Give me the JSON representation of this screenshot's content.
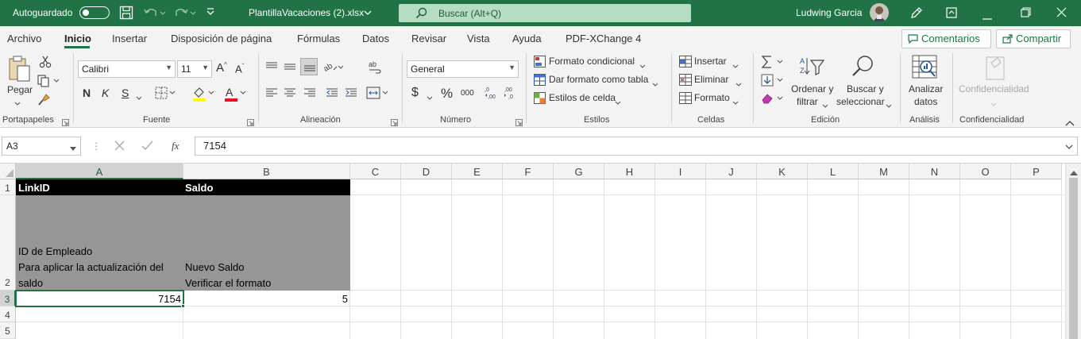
{
  "titlebar": {
    "autosave_label": "Autoguardado",
    "filename": "PlantillaVacaciones (2).xlsx",
    "search_placeholder": "Buscar (Alt+Q)",
    "user_name": "Ludwing Garcia"
  },
  "menu": {
    "tabs": [
      "Archivo",
      "Inicio",
      "Insertar",
      "Disposición de página",
      "Fórmulas",
      "Datos",
      "Revisar",
      "Vista",
      "Ayuda",
      "PDF-XChange 4"
    ],
    "comments_label": "Comentarios",
    "share_label": "Compartir"
  },
  "ribbon": {
    "clipboard": {
      "paste_label": "Pegar",
      "group": "Portapapeles"
    },
    "font": {
      "name": "Calibri",
      "size": "11",
      "bold": "N",
      "italic": "K",
      "underline": "S",
      "group": "Fuente"
    },
    "alignment": {
      "group": "Alineación"
    },
    "number": {
      "format": "General",
      "currency": "$",
      "percent": "%",
      "thousands": "000",
      "group": "Número"
    },
    "styles": {
      "conditional": "Formato condicional",
      "table": "Dar formato como tabla",
      "cell_styles": "Estilos de celda",
      "group": "Estilos"
    },
    "cells": {
      "insert": "Insertar",
      "delete": "Eliminar",
      "format": "Formato",
      "group": "Celdas"
    },
    "editing": {
      "sort_line1": "Ordenar y",
      "sort_line2": "filtrar",
      "find_line1": "Buscar y",
      "find_line2": "seleccionar",
      "group": "Edición"
    },
    "analysis": {
      "line1": "Analizar",
      "line2": "datos",
      "group": "Análisis"
    },
    "sensitivity": {
      "label": "Confidencialidad",
      "group": "Confidencialidad"
    }
  },
  "formulabar": {
    "name_box": "A3",
    "formula": "7154"
  },
  "grid": {
    "columns": [
      "A",
      "B",
      "C",
      "D",
      "E",
      "F",
      "G",
      "H",
      "I",
      "J",
      "K",
      "L",
      "M",
      "N",
      "O",
      "P"
    ],
    "rows": [
      "1",
      "2",
      "3",
      "4",
      "5"
    ],
    "cells": {
      "A1": "LinkID",
      "B1": "Saldo",
      "A2_line1": "ID de Empleado",
      "A2_line2": "Para aplicar la actualización del",
      "A2_line3": "saldo",
      "B2_line1": "Nuevo Saldo",
      "B2_line2": "Verificar el formato",
      "A3": "7154",
      "B3": "5"
    }
  },
  "colors": {
    "accent": "#217346",
    "header_fill": "#000000",
    "note_fill": "#969696"
  }
}
